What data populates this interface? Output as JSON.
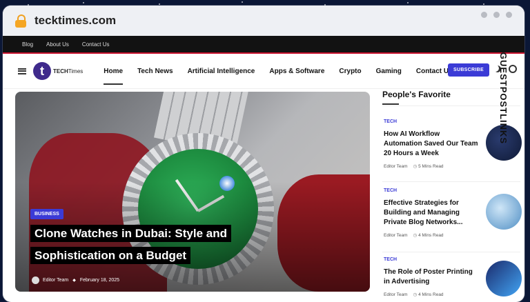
{
  "browser": {
    "url": "tecktimes.com"
  },
  "topbar": {
    "items": [
      "Blog",
      "About Us",
      "Contact Us"
    ]
  },
  "logo": {
    "letter": "t",
    "text_bold": "TECH",
    "text_rest": "Times"
  },
  "nav": {
    "items": [
      "Home",
      "Tech News",
      "Artificial Intelligence",
      "Apps & Software",
      "Crypto",
      "Gaming",
      "Contact Us"
    ],
    "subscribe_label": "SUBSCRIBE"
  },
  "hero": {
    "category": "BUSINESS",
    "title": "Clone Watches in Dubai: Style and Sophistication on a Budget",
    "author": "Editor Team",
    "date": "February 18, 2025"
  },
  "sidebar": {
    "title": "People's Favorite",
    "items": [
      {
        "category": "TECH",
        "title": "How AI Workflow Automation Saved Our Team 20 Hours a Week",
        "author": "Editor Team",
        "read_time": "5 Mins Read"
      },
      {
        "category": "TECH",
        "title": "Effective Strategies for Building and Managing Private Blog Networks...",
        "author": "Editor Team",
        "read_time": "4 Mins Read"
      },
      {
        "category": "TECH",
        "title": "The Role of Poster Printing in Advertising",
        "author": "Editor Team",
        "read_time": "4 Mins Read"
      }
    ]
  },
  "watermark": "GUESTPOSTLINKS",
  "colors": {
    "accent": "#3b3bd6",
    "topbar": "#121212",
    "red": "#c8102e",
    "background": "#0b1736"
  }
}
